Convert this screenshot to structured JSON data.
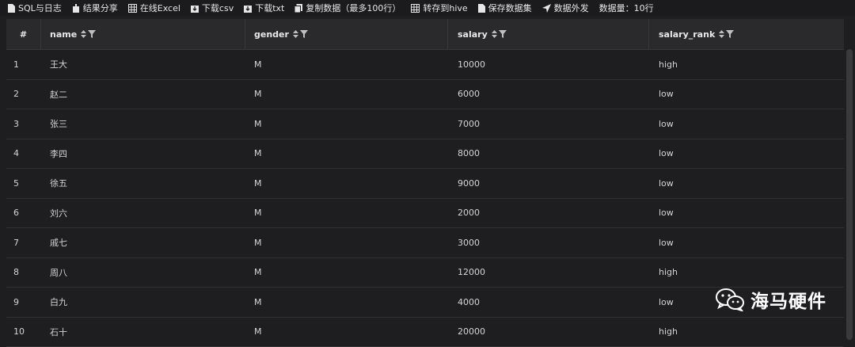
{
  "toolbar": {
    "items": [
      {
        "label": "SQL与日志",
        "icon": "file-icon"
      },
      {
        "label": "结果分享",
        "icon": "share-icon"
      },
      {
        "label": "在线Excel",
        "icon": "grid-icon"
      },
      {
        "label": "下载csv",
        "icon": "download-icon"
      },
      {
        "label": "下载txt",
        "icon": "download-icon"
      },
      {
        "label": "复制数据（最多100行）",
        "icon": "copy-icon"
      },
      {
        "label": "转存到hive",
        "icon": "grid-icon"
      },
      {
        "label": "保存数据集",
        "icon": "file-icon"
      },
      {
        "label": "数据外发",
        "icon": "send-icon"
      }
    ],
    "row_count_label": "数据量：10行"
  },
  "table": {
    "columns": [
      "#",
      "name",
      "gender",
      "salary",
      "salary_rank"
    ],
    "rows": [
      [
        "1",
        "王大",
        "M",
        "10000",
        "high"
      ],
      [
        "2",
        "赵二",
        "M",
        "6000",
        "low"
      ],
      [
        "3",
        "张三",
        "M",
        "7000",
        "low"
      ],
      [
        "4",
        "李四",
        "M",
        "8000",
        "low"
      ],
      [
        "5",
        "徐五",
        "M",
        "9000",
        "low"
      ],
      [
        "6",
        "刘六",
        "M",
        "2000",
        "low"
      ],
      [
        "7",
        "戚七",
        "M",
        "3000",
        "low"
      ],
      [
        "8",
        "周八",
        "M",
        "12000",
        "high"
      ],
      [
        "9",
        "白九",
        "M",
        "4000",
        "low"
      ],
      [
        "10",
        "石十",
        "M",
        "20000",
        "high"
      ]
    ]
  },
  "watermark": {
    "text": "海马硬件",
    "icon": "wechat-icon"
  },
  "colors": {
    "background": "#1e1e21",
    "header": "#2a2a2d",
    "text": "#d4d4d4"
  }
}
